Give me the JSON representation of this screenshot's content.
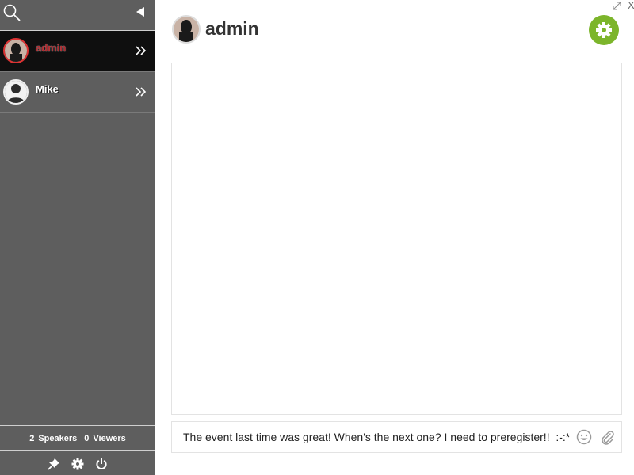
{
  "sidebar": {
    "icons": {
      "search": "search-icon",
      "collapse": "collapse-left-icon"
    },
    "users": [
      {
        "name": "admin",
        "name_color": "#b3262b",
        "active": true,
        "avatar": "photo",
        "arrow": "double-chevron-right-icon"
      },
      {
        "name": "Mike",
        "name_color": "#ffffff",
        "active": false,
        "avatar": "silhouette",
        "arrow": "double-chevron-right-icon"
      }
    ],
    "stats": {
      "speakers_count": "2",
      "speakers_label": "Speakers",
      "viewers_count": "0",
      "viewers_label": "Viewers"
    },
    "tools": [
      "pin-icon",
      "gear-icon",
      "power-icon"
    ]
  },
  "header": {
    "username": "admin",
    "settings_color": "#7cb52b"
  },
  "window": {
    "close_label": "X"
  },
  "composer": {
    "value": "The event last time was great! When's the next one? I need to preregister!!  :-:*",
    "icons": [
      "smiley-icon",
      "paperclip-icon"
    ]
  },
  "colors": {
    "sidebar_bg": "#5e5e5e",
    "active_row_bg": "#0f0f0f",
    "accent": "#7cb52b"
  }
}
